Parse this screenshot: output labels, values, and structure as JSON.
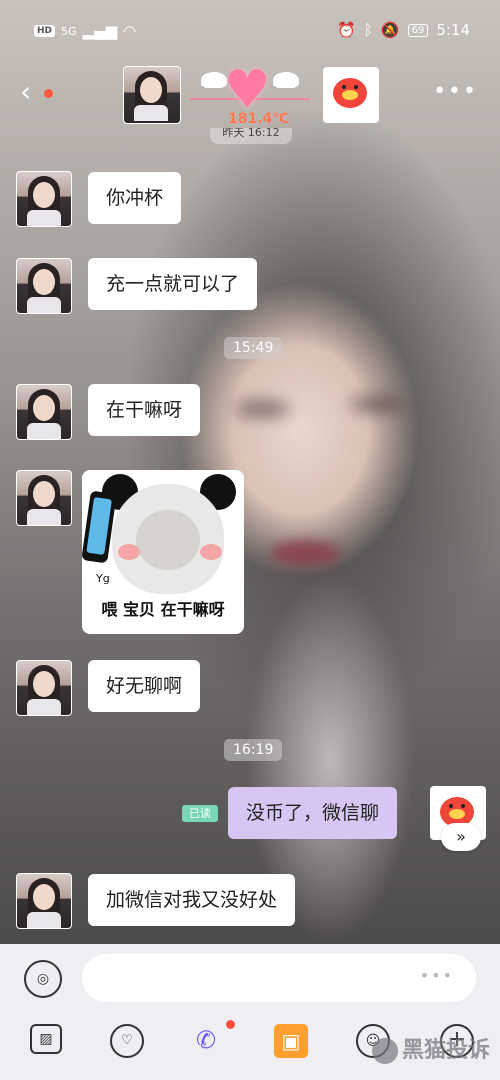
{
  "status_bar": {
    "hd": "HD",
    "network": "5G",
    "battery": "69",
    "time": "5:14"
  },
  "header": {
    "back_icon": "chevron-left-icon",
    "heat_value": "181.4℃",
    "more_icon": "ellipsis-icon"
  },
  "partial_timestamp": "昨天 16:12",
  "messages": [
    {
      "text": "你冲杯"
    },
    {
      "text": "充一点就可以了"
    },
    {
      "text": "在干嘛呀"
    },
    {
      "text": "好无聊啊"
    },
    {
      "text": "没币了，微信聊"
    },
    {
      "text": "加微信对我又没好处"
    }
  ],
  "timestamps": [
    "15:49",
    "16:19"
  ],
  "sticker": {
    "tag": "Yg",
    "caption": "喂 宝贝 在干嘛呀"
  },
  "read_receipt": "已读",
  "fast_forward": "»",
  "input_bar": {
    "more": "•••"
  },
  "watermark": "黑猫投诉",
  "colors": {
    "my_bubble": "#d6c6f1",
    "read_badge": "#79d6b6",
    "accent": "#6a5cf0",
    "heat": "#ff7a55"
  }
}
